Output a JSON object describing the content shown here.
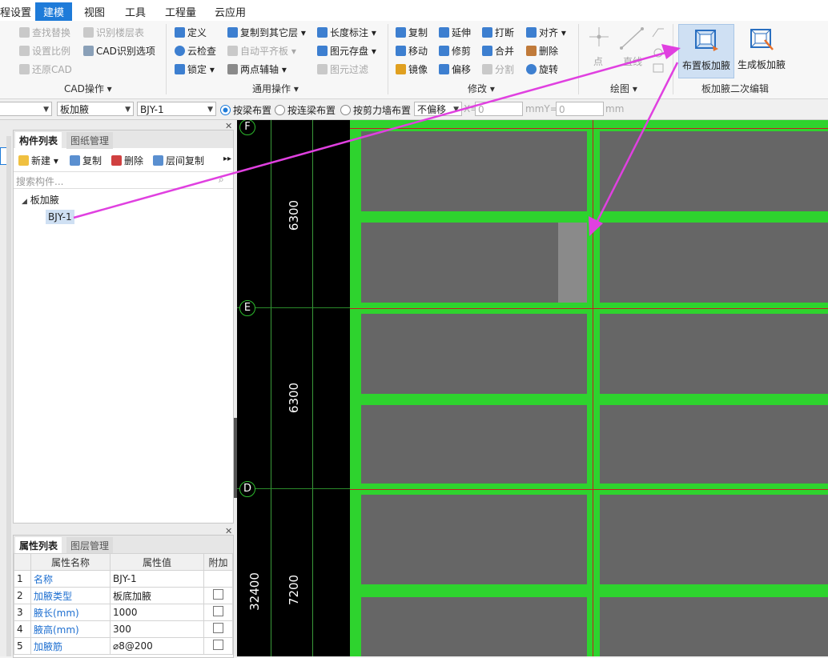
{
  "menu": {
    "items": [
      "程设置",
      "建模",
      "视图",
      "工具",
      "工程量",
      "云应用"
    ],
    "active_index": 1
  },
  "ribbon": {
    "cad_ops": {
      "items": [
        "查找替换",
        "识别楼层表",
        "设置比例",
        "CAD识别选项",
        "还原CAD"
      ],
      "label": "CAD操作 ▾"
    },
    "general_ops": {
      "items": [
        "定义",
        "复制到其它层 ▾",
        "长度标注 ▾",
        "云检查",
        "自动平齐板 ▾",
        "图元存盘 ▾",
        "锁定 ▾",
        "两点辅轴 ▾",
        "图元过滤"
      ],
      "label": "通用操作 ▾"
    },
    "modify": {
      "items": [
        "复制",
        "延伸",
        "打断",
        "对齐 ▾",
        "移动",
        "修剪",
        "合并",
        "删除",
        "镜像",
        "偏移",
        "分割",
        "旋转"
      ],
      "label": "修改 ▾"
    },
    "draw": {
      "items": [
        "点",
        "直线"
      ],
      "label": "绘图 ▾"
    },
    "haunch": {
      "place_button": "布置板加腋",
      "generate_button": "生成板加腋",
      "label": "板加腋二次编辑"
    }
  },
  "optbar": {
    "combo1": "",
    "combo2": "板加腋",
    "combo3": "BJY-1",
    "radio1": "按梁布置",
    "radio2": "按连梁布置",
    "radio3": "按剪力墙布置",
    "offset_combo": "不偏移",
    "x_label": "X=",
    "x_value": "0",
    "mmy_label": "mmY=",
    "y_value": "0",
    "mm_label": "mm"
  },
  "component_panel": {
    "tabs": [
      "构件列表",
      "图纸管理"
    ],
    "toolbar": [
      "新建 ▾",
      "复制",
      "删除",
      "层间复制"
    ],
    "search_placeholder": "搜索构件...",
    "tree_group": "板加腋",
    "tree_item": "BJY-1"
  },
  "property_panel": {
    "tabs": [
      "属性列表",
      "图层管理"
    ],
    "headers": [
      "",
      "属性名称",
      "属性值",
      "附加"
    ],
    "rows": [
      {
        "no": "1",
        "name": "名称",
        "value": "BJY-1",
        "has_check": false
      },
      {
        "no": "2",
        "name": "加腋类型",
        "value": "板底加腋",
        "has_check": true
      },
      {
        "no": "3",
        "name": "腋长(mm)",
        "value": "1000",
        "has_check": true
      },
      {
        "no": "4",
        "name": "腋高(mm)",
        "value": "300",
        "has_check": true
      },
      {
        "no": "5",
        "name": "加腋筋",
        "value": "⌀8@200",
        "has_check": true
      }
    ]
  },
  "canvas": {
    "axes": [
      "F",
      "E",
      "D"
    ],
    "dims": [
      "6300",
      "6300",
      "7200",
      "32400"
    ]
  },
  "colors": {
    "accent": "#1e7bd9",
    "beam_green": "#2ed32e",
    "slab_gray": "#666666",
    "annotation_arrow": "#e040e0"
  }
}
